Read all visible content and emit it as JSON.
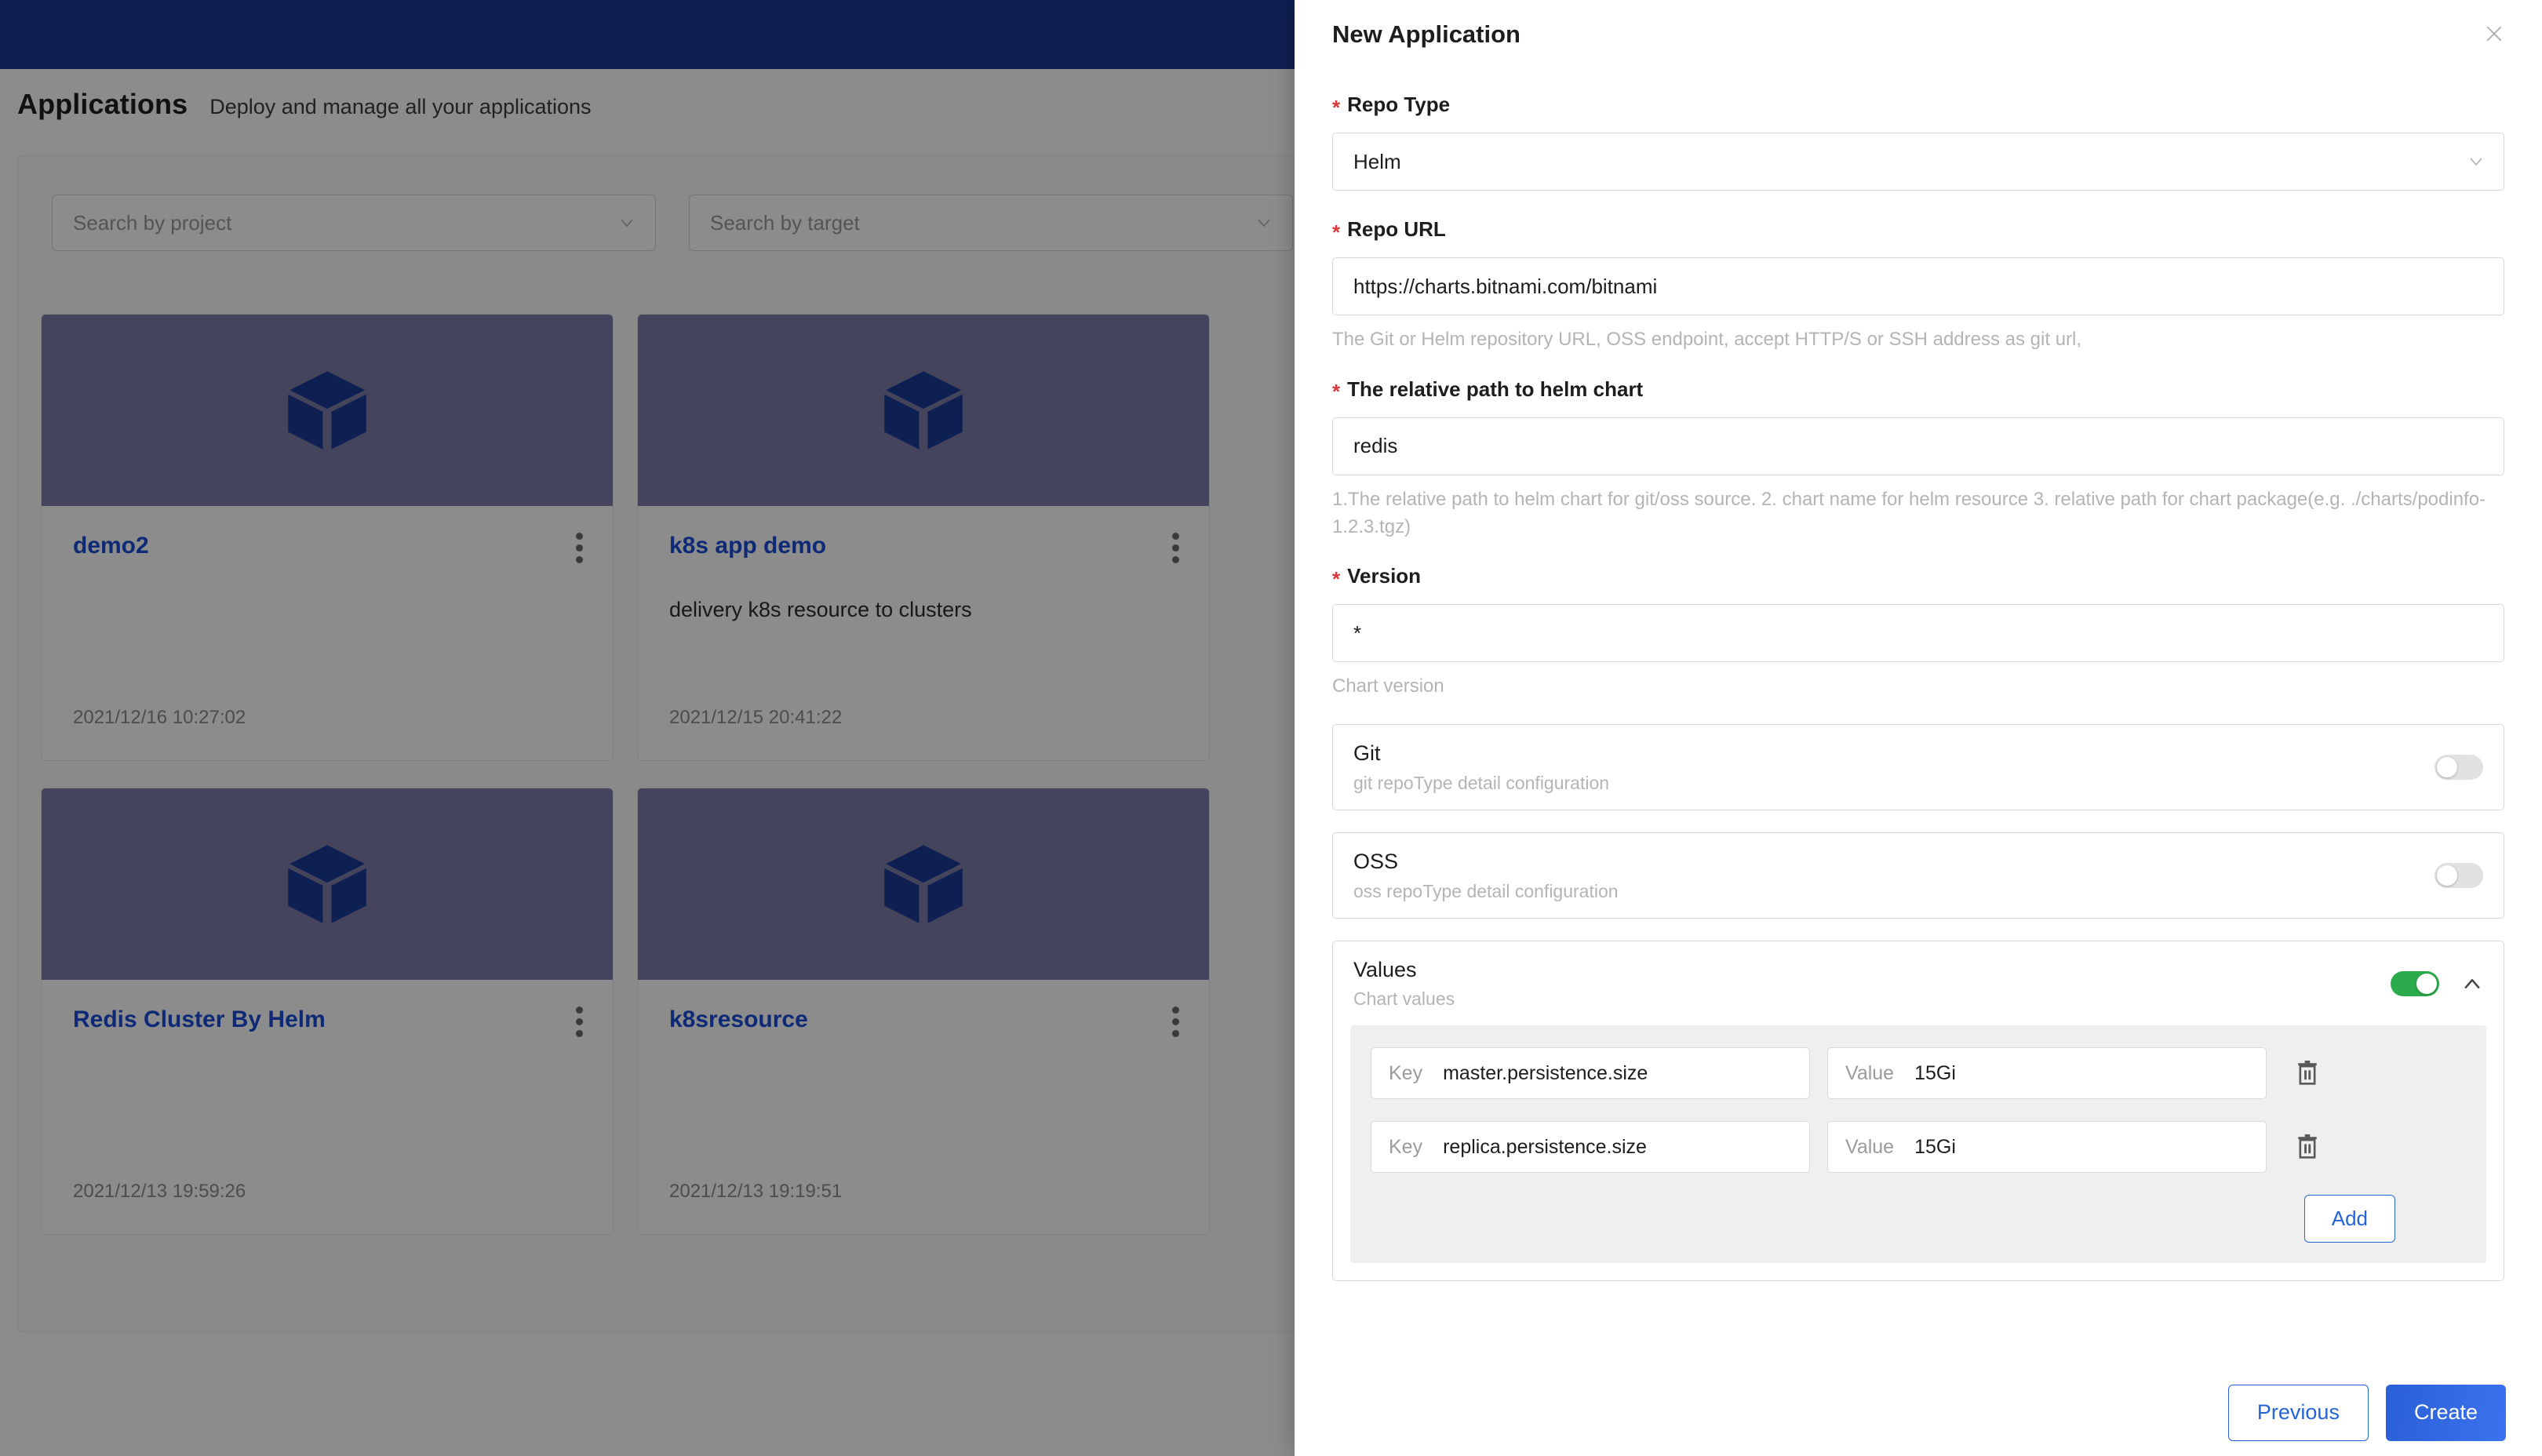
{
  "background": {
    "page_title": "Applications",
    "page_subtitle": "Deploy and manage all your applications",
    "filters": [
      {
        "name": "search-by-project",
        "placeholder": "Search by project"
      },
      {
        "name": "search-by-target",
        "placeholder": "Search by target"
      }
    ],
    "cards": [
      {
        "name": "demo2",
        "description": "",
        "time": "2021/12/16 10:27:02",
        "icon": "cube-icon"
      },
      {
        "name": "k8s app demo",
        "description": "delivery k8s resource to clusters",
        "time": "2021/12/15 20:41:22",
        "icon": "cube-icon"
      },
      {
        "name": "Redis Cluster By Helm",
        "description": "",
        "time": "2021/12/13 19:59:26",
        "icon": "cube-icon"
      },
      {
        "name": "k8sresource",
        "description": "",
        "time": "2021/12/13 19:19:51",
        "icon": "cube-icon"
      }
    ]
  },
  "drawer": {
    "title": "New Application",
    "close_icon": "close-icon",
    "fields": {
      "repo_type": {
        "label": "Repo Type",
        "required_mark": "*",
        "value": "Helm",
        "chevron": "chevron-down-icon"
      },
      "repo_url": {
        "label": "Repo URL",
        "required_mark": "*",
        "value": "https://charts.bitnami.com/bitnami",
        "help": "The Git or Helm repository URL, OSS endpoint, accept HTTP/S or SSH address as git url,"
      },
      "helm_chart_path": {
        "label": "The relative path to helm chart",
        "required_mark": "*",
        "value": "redis",
        "help": "1.The relative path to helm chart for git/oss source. 2. chart name for helm resource 3. relative path for chart package(e.g. ./charts/podinfo-1.2.3.tgz)"
      },
      "version": {
        "label": "Version",
        "required_mark": "*",
        "value": "*",
        "help": "Chart version"
      }
    },
    "sections": [
      {
        "key": "git",
        "title": "Git",
        "subtitle": "git repoType detail configuration",
        "toggle_on": false,
        "toggle_color": "#e2e2e2"
      },
      {
        "key": "oss",
        "title": "OSS",
        "subtitle": "oss repoType detail configuration",
        "toggle_on": false,
        "toggle_color": "#e2e2e2"
      },
      {
        "key": "values",
        "title": "Values",
        "subtitle": "Chart values",
        "toggle_on": true,
        "toggle_color": "#2bab4b",
        "collapse_icon": "chevron-up-icon"
      }
    ],
    "values_rows": [
      {
        "key_label": "Key",
        "key_value": "master.persistence.size",
        "value_label": "Value",
        "value_value": "15Gi",
        "delete_icon": "trash-icon"
      },
      {
        "key_label": "Key",
        "key_value": "replica.persistence.size",
        "value_label": "Value",
        "value_value": "15Gi",
        "delete_icon": "trash-icon"
      }
    ],
    "add_button": "Add",
    "footer": {
      "previous": "Previous",
      "create": "Create"
    }
  },
  "theme": {
    "topbar": "#1b3a94",
    "primary": "#2563d9",
    "link": "#1a4ed8",
    "required": "#d9363e",
    "toggle_on": "#2bab4b",
    "card_thumb": "#7c7faa"
  }
}
